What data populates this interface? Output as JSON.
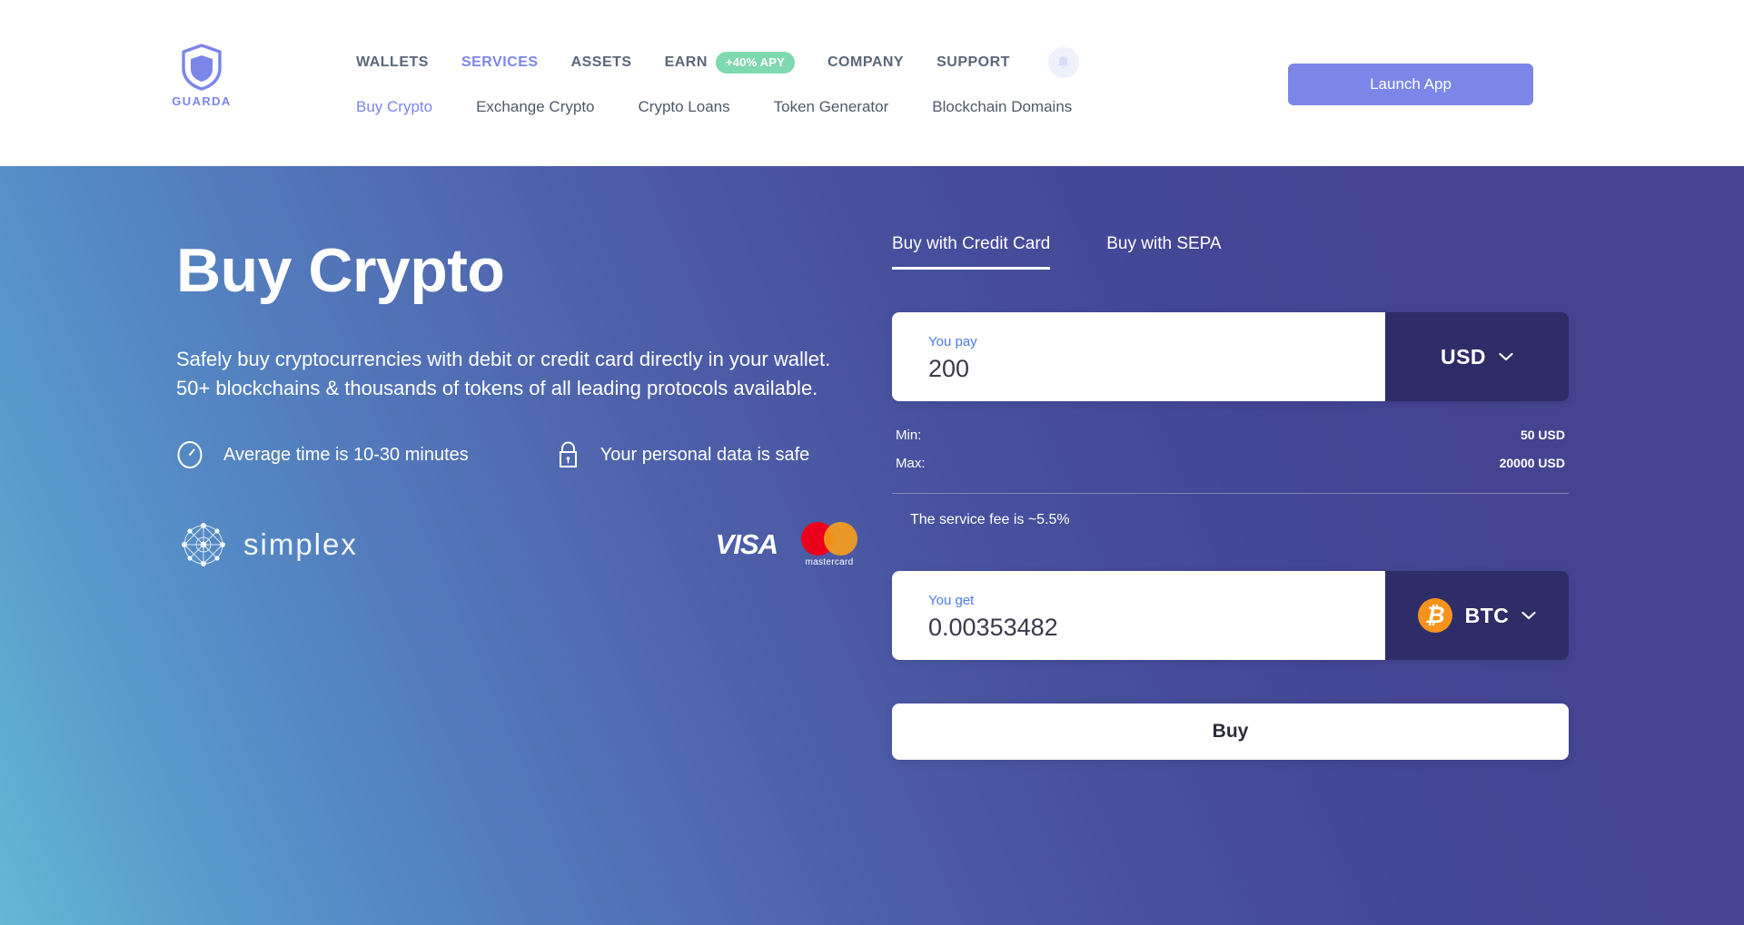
{
  "header": {
    "logo": {
      "name": "GUARDA",
      "icon": "shield-icon"
    },
    "nav_primary": [
      {
        "label": "WALLETS",
        "active": false
      },
      {
        "label": "SERVICES",
        "active": true
      },
      {
        "label": "ASSETS",
        "active": false
      },
      {
        "label": "EARN",
        "active": false,
        "badge": "+40% APY"
      },
      {
        "label": "COMPANY",
        "active": false
      },
      {
        "label": "SUPPORT",
        "active": false
      }
    ],
    "notification_icon": "bell-icon",
    "nav_secondary": [
      {
        "label": "Buy Crypto",
        "active": true
      },
      {
        "label": "Exchange Crypto",
        "active": false
      },
      {
        "label": "Crypto Loans",
        "active": false
      },
      {
        "label": "Token Generator",
        "active": false
      },
      {
        "label": "Blockchain Domains",
        "active": false
      }
    ],
    "launch_button": "Launch App"
  },
  "hero": {
    "title": "Buy Crypto",
    "description": "Safely buy cryptocurrencies with debit or credit card directly in your wallet. 50+ blockchains & thousands of tokens of all leading protocols available.",
    "features": [
      {
        "icon": "clock-icon",
        "label": "Average time is 10-30 minutes"
      },
      {
        "icon": "lock-icon",
        "label": "Your personal data is safe"
      }
    ],
    "provider": {
      "icon": "simplex-network-icon",
      "name": "simplex"
    },
    "payment_methods": [
      {
        "icon": "visa-icon",
        "label": "VISA"
      },
      {
        "icon": "mastercard-icon",
        "label": "mastercard"
      }
    ]
  },
  "form": {
    "tabs": [
      {
        "label": "Buy with Credit Card",
        "active": true
      },
      {
        "label": "Buy with SEPA",
        "active": false
      }
    ],
    "pay": {
      "label": "You pay",
      "value": "200",
      "placeholder": "0",
      "currency": "USD",
      "chevron": "chevron-down-icon"
    },
    "limits": [
      {
        "label": "Min:",
        "value": "50 USD"
      },
      {
        "label": "Max:",
        "value": "20000 USD"
      }
    ],
    "fee_note": "The service fee is ~5.5%",
    "get": {
      "label": "You get",
      "value": "0.00353482",
      "placeholder": "0",
      "currency": "BTC",
      "coin_icon": "bitcoin-icon",
      "coin_glyph": "₿",
      "chevron": "chevron-down-icon"
    },
    "submit_label": "Buy"
  },
  "colors": {
    "accent": "#7b86e8",
    "badge_green": "#7ed9af",
    "select_dark": "#2f2d68",
    "bitcoin_orange": "#f7931a",
    "link_blue": "#4a7bf0"
  }
}
